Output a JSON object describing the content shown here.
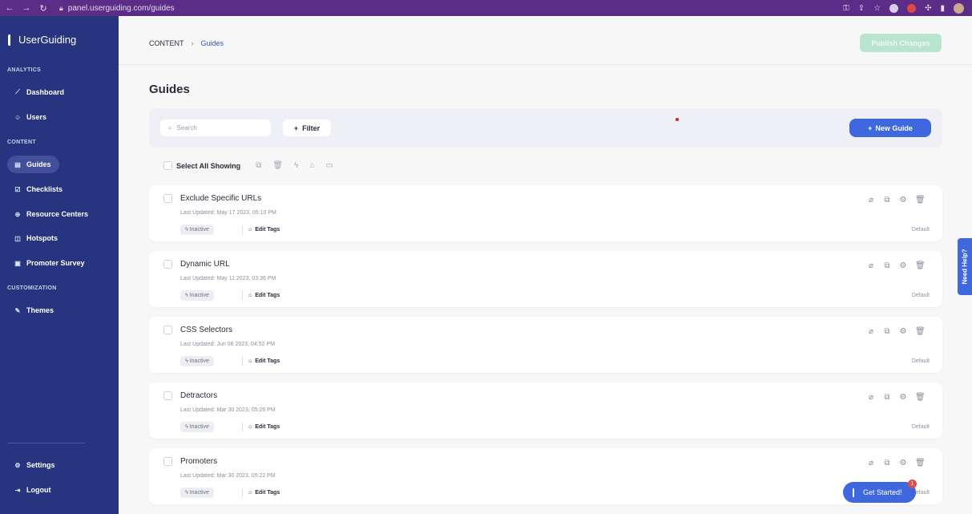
{
  "browser": {
    "url": "panel.userguiding.com/guides"
  },
  "sidebar": {
    "logo": "UserGuiding",
    "sections": [
      {
        "label": "ANALYTICS"
      },
      {
        "label": "CONTENT"
      },
      {
        "label": "CUSTOMIZATION"
      }
    ],
    "items": [
      {
        "label": "Dashboard",
        "icon": "chart-line-icon"
      },
      {
        "label": "Users",
        "icon": "user-icon"
      },
      {
        "label": "Guides",
        "icon": "guide-icon"
      },
      {
        "label": "Checklists",
        "icon": "checklist-icon"
      },
      {
        "label": "Resource Centers",
        "icon": "globe-icon"
      },
      {
        "label": "Hotspots",
        "icon": "hotspot-icon"
      },
      {
        "label": "Promoter Survey",
        "icon": "survey-icon"
      },
      {
        "label": "Themes",
        "icon": "brush-icon"
      },
      {
        "label": "Settings",
        "icon": "gear-icon"
      },
      {
        "label": "Logout",
        "icon": "logout-icon"
      }
    ]
  },
  "header": {
    "breadcrumb_root": "CONTENT",
    "breadcrumb_current": "Guides",
    "publish_label": "Publish Changes"
  },
  "main": {
    "title": "Guides",
    "search_placeholder": "Search",
    "filter_label": "Filter",
    "new_guide_label": "New Guide",
    "select_all_label": "Select All Showing"
  },
  "guides": [
    {
      "name": "Exclude Specific URLs",
      "updated": "Last Updated: May 17 2023, 05:10 PM",
      "status": "Inactive",
      "tags_label": "Edit Tags",
      "theme": "Default"
    },
    {
      "name": "Dynamic URL",
      "updated": "Last Updated: May 11 2023, 03:36 PM",
      "status": "Inactive",
      "tags_label": "Edit Tags",
      "theme": "Default"
    },
    {
      "name": "CSS Selectors",
      "updated": "Last Updated: Jun 06 2023, 04:52 PM",
      "status": "Inactive",
      "tags_label": "Edit Tags",
      "theme": "Default"
    },
    {
      "name": "Detractors",
      "updated": "Last Updated: Mar 30 2023, 05:26 PM",
      "status": "Inactive",
      "tags_label": "Edit Tags",
      "theme": "Default"
    },
    {
      "name": "Promoters",
      "updated": "Last Updated: Mar 30 2023, 05:22 PM",
      "status": "Inactive",
      "tags_label": "Edit Tags",
      "theme": "Default"
    }
  ],
  "widgets": {
    "need_help": "Need Help?",
    "get_started": "Get Started!",
    "get_started_badge": "1"
  },
  "colors": {
    "sidebar": "#273580",
    "accent": "#3f68df",
    "browser": "#5b2d86",
    "publish_disabled": "#b9e4d0"
  }
}
